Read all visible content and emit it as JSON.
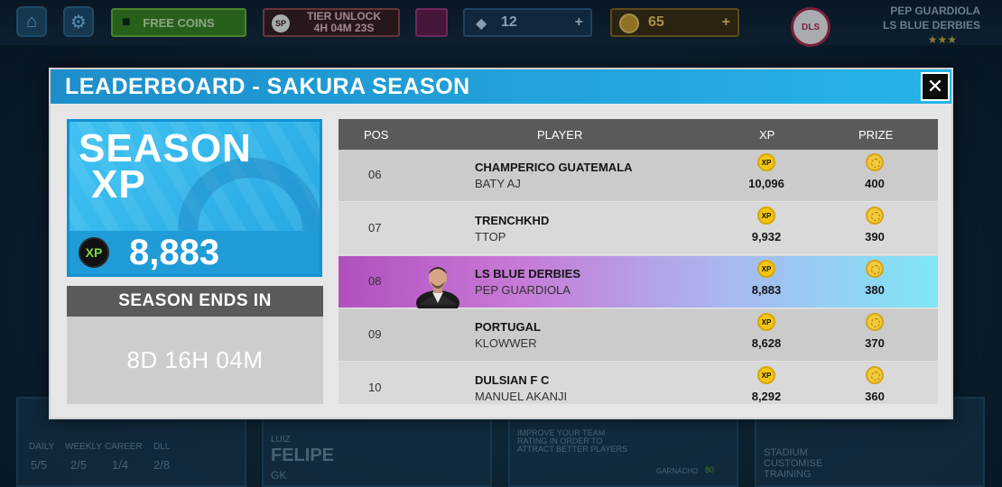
{
  "topbar": {
    "free_coins_label": "FREE COINS",
    "tier_unlock_label": "TIER UNLOCK",
    "tier_unlock_timer": "4H 04M 23S",
    "sp_badge": "SP",
    "gems_value": "12",
    "coins_value": "65",
    "club_badge": "DLS",
    "profile_name": "PEP GUARDIOLA",
    "profile_club": "LS BLUE DERBIES",
    "profile_stars": "★★★",
    "plus_symbol": "+"
  },
  "modal": {
    "title": "LEADERBOARD - SAKURA SEASON",
    "close_symbol": "✕"
  },
  "season_xp": {
    "title_line1": "SEASON",
    "title_line2": "XP",
    "badge": "XP",
    "value": "8,883"
  },
  "season_end": {
    "label": "SEASON ENDS IN",
    "countdown": "8D 16H 04M"
  },
  "table": {
    "headers": {
      "pos": "POS",
      "player": "PLAYER",
      "xp": "XP",
      "prize": "PRIZE"
    },
    "xp_icon_text": "XP",
    "rows": [
      {
        "pos": "06",
        "name": "CHAMPERICO GUATEMALA",
        "club": "BATY AJ",
        "xp": "10,096",
        "prize": "400"
      },
      {
        "pos": "07",
        "name": "TRENCHKHD",
        "club": "TTOP",
        "xp": "9,932",
        "prize": "390"
      },
      {
        "pos": "08",
        "name": "LS BLUE DERBIES",
        "club": "PEP GUARDIOLA",
        "xp": "8,883",
        "prize": "380"
      },
      {
        "pos": "09",
        "name": "PORTUGAL",
        "club": "KLOWWER",
        "xp": "8,628",
        "prize": "370"
      },
      {
        "pos": "10",
        "name": "DULSIAN F C",
        "club": "MANUEL AKANJI",
        "xp": "8,292",
        "prize": "360"
      }
    ]
  },
  "background": {
    "tabs": [
      "DAILY",
      "WEEKLY",
      "CAREER",
      "DLL"
    ],
    "tab_values": [
      "5/5",
      "2/5",
      "1/4",
      "2/8"
    ],
    "player_first": "LUIZ",
    "player_last": "FELIPE",
    "player_pos": "GK",
    "improve_text": "IMPROVE YOUR TEAM RATING IN ORDER TO ATTRACT BETTER PLAYERS",
    "garnacho": "GARNACHO",
    "garnacho_rating": "80",
    "stadium_text": "STADIUM CUSTOMISE TRAINING"
  },
  "colors": {
    "header_blue": "#26b4e8",
    "highlight_row_start": "#b24fc0",
    "highlight_row_end": "#7fe6f5",
    "xp_badge_green": "#7bdc3c"
  }
}
